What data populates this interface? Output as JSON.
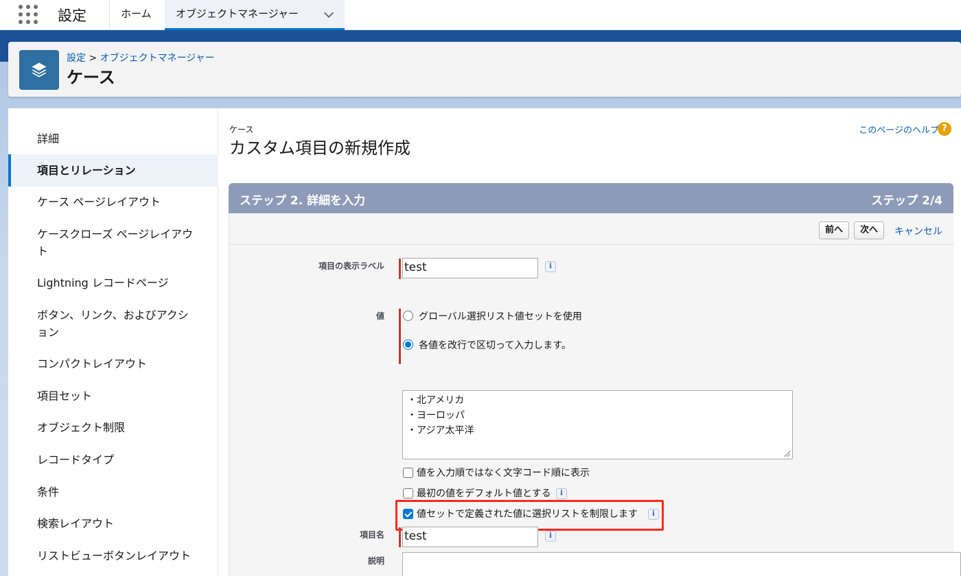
{
  "topnav": {
    "app_name": "設定",
    "tabs": [
      {
        "label": "ホーム"
      },
      {
        "label": "オブジェクトマネージャー"
      }
    ]
  },
  "header": {
    "breadcrumb_root": "設定",
    "breadcrumb_sep": " > ",
    "breadcrumb_current": "オブジェクトマネージャー",
    "title": "ケース"
  },
  "sidebar": {
    "items": [
      {
        "label": "詳細"
      },
      {
        "label": "項目とリレーション"
      },
      {
        "label": "ケース ページレイアウト"
      },
      {
        "label": "ケースクローズ ページレイアウト"
      },
      {
        "label": "Lightning レコードページ"
      },
      {
        "label": "ボタン、リンク、およびアクション"
      },
      {
        "label": "コンパクトレイアウト"
      },
      {
        "label": "項目セット"
      },
      {
        "label": "オブジェクト制限"
      },
      {
        "label": "レコードタイプ"
      },
      {
        "label": "条件"
      },
      {
        "label": "検索レイアウト"
      },
      {
        "label": "リストビューボタンレイアウト"
      }
    ]
  },
  "main": {
    "subtitle": "ケース",
    "title": "カスタム項目の新規作成",
    "help_label": "このページのヘルプ",
    "help_icon": "?",
    "step_title": "ステップ 2. 詳細を入力",
    "step_counter": "ステップ 2/4",
    "buttons": {
      "prev": "前へ",
      "next": "次へ",
      "cancel": "キャンセル"
    },
    "form": {
      "label_field_label": "項目の表示ラベル",
      "label_field_value": "test",
      "values_label": "値",
      "option_global": "グローバル選択リスト値セットを使用",
      "option_each": "各値を改行で区切って入力します。",
      "values_text": [
        "・北アメリカ",
        "・ヨーロッパ",
        "・アジア太平洋"
      ],
      "sort_alpha": "値を入力順ではなく文字コード順に表示",
      "first_default": "最初の値をデフォルト値とする",
      "restrict_values": "値セットで定義された値に選択リストを制限します",
      "field_name_label": "項目名",
      "field_name_value": "test",
      "description_label": "説明",
      "info_glyph": "i"
    }
  },
  "colors": {
    "brand_blue": "#0176d3",
    "step_bar": "#8e9bb8",
    "required": "#c23934",
    "highlight": "#ff2a1a",
    "help_icon": "#e4a201"
  },
  "icons": [
    "app-launcher-icon",
    "chevron-down-icon",
    "object-layers-icon",
    "help-icon",
    "info-icon",
    "resize-handle-icon"
  ]
}
